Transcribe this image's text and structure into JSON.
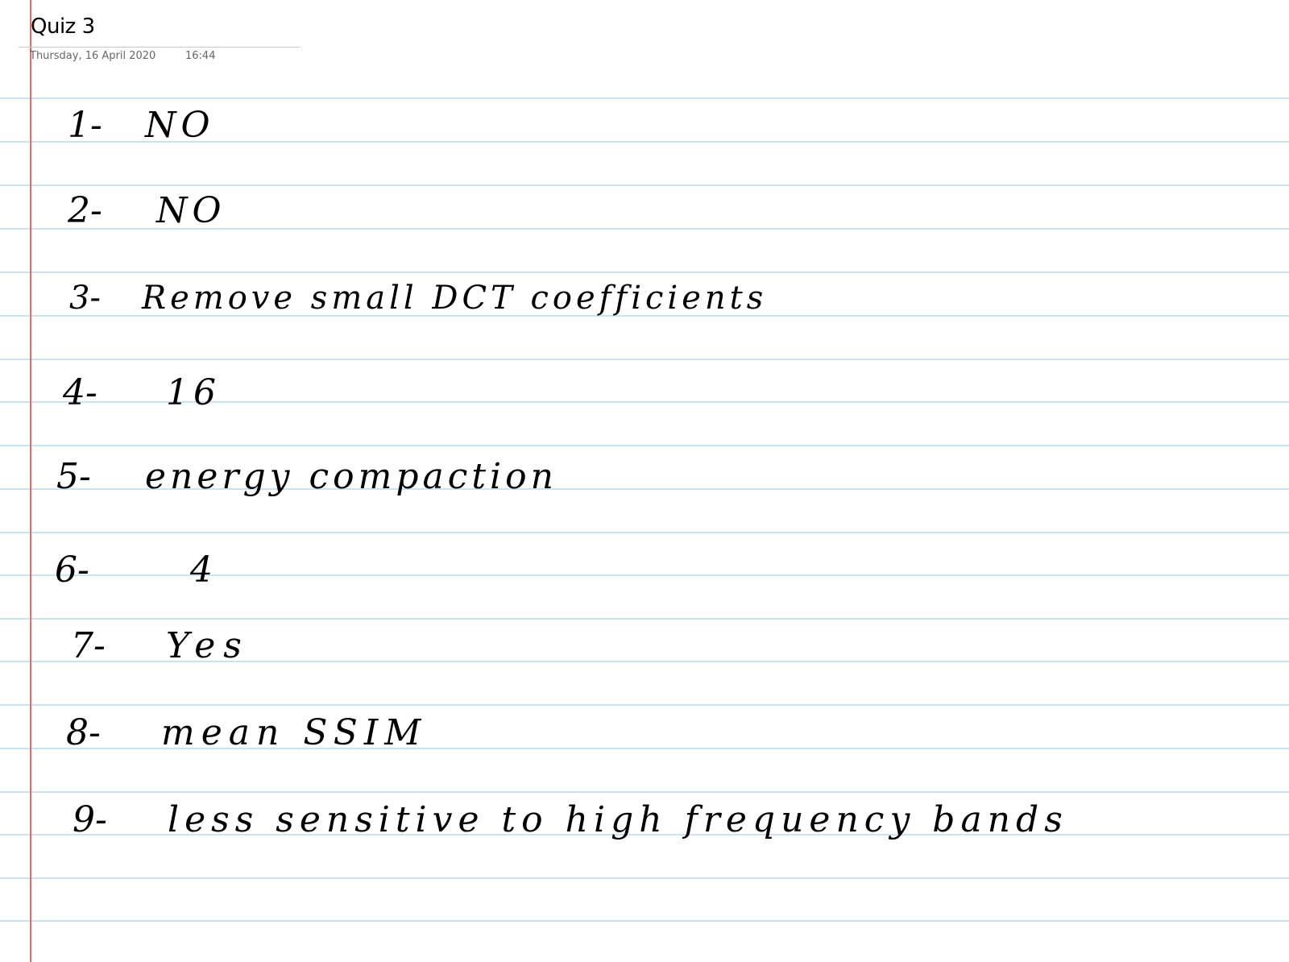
{
  "page": {
    "title": "Quiz 3",
    "date": "Thursday, 16 April 2020",
    "time": "16:44"
  },
  "answers": [
    {
      "number": "1-",
      "text": "NO"
    },
    {
      "number": "2-",
      "text": "NO"
    },
    {
      "number": "3-",
      "text": "Remove small DCT coefficients"
    },
    {
      "number": "4-",
      "text": "16"
    },
    {
      "number": "5-",
      "text": "energy compaction"
    },
    {
      "number": "6-",
      "text": "4"
    },
    {
      "number": "7-",
      "text": "Yes"
    },
    {
      "number": "8-",
      "text": "mean SSIM"
    },
    {
      "number": "9-",
      "text": "less sensitive to high frequency bands"
    }
  ],
  "colors": {
    "rule": "#c9e4f2",
    "margin": "#e26b6b",
    "ink": "#000000"
  }
}
